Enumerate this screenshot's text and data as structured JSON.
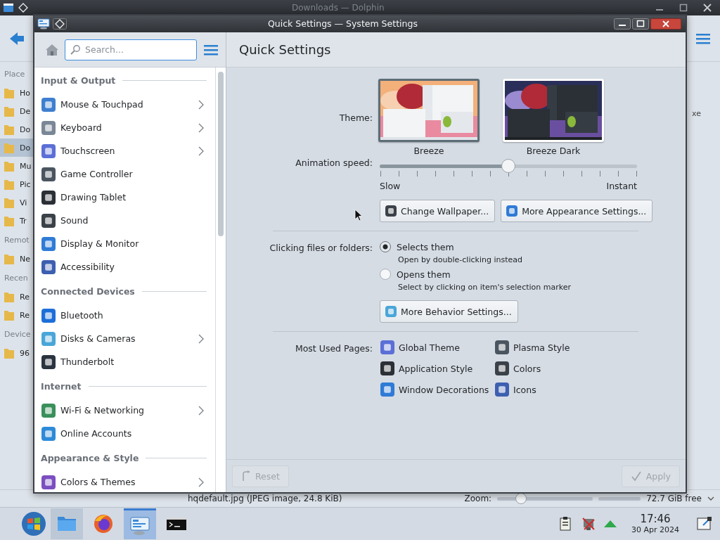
{
  "dolphin": {
    "title": "Downloads — Dolphin",
    "places": [
      {
        "kind": "heading",
        "text": "Place"
      },
      {
        "kind": "item",
        "text": "Ho",
        "selected": false
      },
      {
        "kind": "item",
        "text": "De",
        "selected": false
      },
      {
        "kind": "item",
        "text": "Do",
        "selected": false
      },
      {
        "kind": "item",
        "text": "Do",
        "selected": true
      },
      {
        "kind": "item",
        "text": "Mu",
        "selected": false
      },
      {
        "kind": "item",
        "text": "Pic",
        "selected": false
      },
      {
        "kind": "item",
        "text": "Vi",
        "selected": false
      },
      {
        "kind": "item",
        "text": "Tr",
        "selected": false
      },
      {
        "kind": "heading",
        "text": "Remot"
      },
      {
        "kind": "item",
        "text": "Ne",
        "selected": false
      },
      {
        "kind": "heading",
        "text": "Recen"
      },
      {
        "kind": "item",
        "text": "Re",
        "selected": false
      },
      {
        "kind": "item",
        "text": "Re",
        "selected": false
      },
      {
        "kind": "heading",
        "text": "Device"
      },
      {
        "kind": "item",
        "text": "96",
        "selected": false
      }
    ],
    "content_edge_text": "xe",
    "status_bar": {
      "file_info": "hqdefault.jpg (JPEG image, 24.8 KiB)",
      "zoom": {
        "label": "Zoom:",
        "level": 0.25
      },
      "free_space": "72.7 GiB free"
    }
  },
  "settings_window": {
    "title": "Quick Settings — System Settings",
    "search": {
      "placeholder": "Search..."
    },
    "page_title": "Quick Settings",
    "sidebar": {
      "sections": [
        {
          "title": "Input & Output",
          "items": [
            {
              "label": "Mouse & Touchpad",
              "submenu": true
            },
            {
              "label": "Keyboard",
              "submenu": true
            },
            {
              "label": "Touchscreen",
              "submenu": true
            },
            {
              "label": "Game Controller",
              "submenu": false
            },
            {
              "label": "Drawing Tablet",
              "submenu": false
            },
            {
              "label": "Sound",
              "submenu": false
            },
            {
              "label": "Display & Monitor",
              "submenu": false
            },
            {
              "label": "Accessibility",
              "submenu": false
            }
          ]
        },
        {
          "title": "Connected Devices",
          "items": [
            {
              "label": "Bluetooth",
              "submenu": false
            },
            {
              "label": "Disks & Cameras",
              "submenu": true
            },
            {
              "label": "Thunderbolt",
              "submenu": false
            }
          ]
        },
        {
          "title": "Internet",
          "items": [
            {
              "label": "Wi-Fi & Networking",
              "submenu": true
            },
            {
              "label": "Online Accounts",
              "submenu": false
            }
          ]
        },
        {
          "title": "Appearance & Style",
          "items": [
            {
              "label": "Colors & Themes",
              "submenu": true
            }
          ]
        }
      ]
    },
    "form": {
      "theme": {
        "label": "Theme:",
        "themes": [
          {
            "name": "Breeze",
            "selected": true
          },
          {
            "name": "Breeze Dark",
            "selected": false
          }
        ]
      },
      "animation": {
        "label": "Animation speed:",
        "level": 0.5,
        "min_label": "Slow",
        "max_label": "Instant"
      },
      "appearance_buttons": [
        "Change Wallpaper...",
        "More Appearance Settings..."
      ],
      "clicking": {
        "label": "Clicking files or folders:",
        "options": [
          {
            "label": "Selects them",
            "description": "Open by double-clicking instead",
            "selected": true
          },
          {
            "label": "Opens them",
            "description": "Select by clicking on item's selection marker",
            "selected": false
          }
        ]
      },
      "behavior_button": "More Behavior Settings...",
      "most_used": {
        "label": "Most Used Pages:",
        "pages": [
          "Global Theme",
          "Plasma Style",
          "Application Style",
          "Colors",
          "Window Decorations",
          "Icons"
        ]
      }
    },
    "footer": {
      "buttons": [
        {
          "label": "Reset",
          "disabled": true
        },
        {
          "label": "Apply",
          "disabled": true
        }
      ]
    }
  },
  "taskbar": {
    "apps": [
      {
        "kind": "files",
        "open": true,
        "selected": false
      },
      {
        "kind": "browser",
        "open": false,
        "selected": false
      },
      {
        "kind": "settings",
        "open": true,
        "selected": true
      },
      {
        "kind": "terminal",
        "open": false,
        "selected": false
      }
    ],
    "clock": {
      "time": "17:46",
      "date": "30 Apr 2024"
    }
  }
}
